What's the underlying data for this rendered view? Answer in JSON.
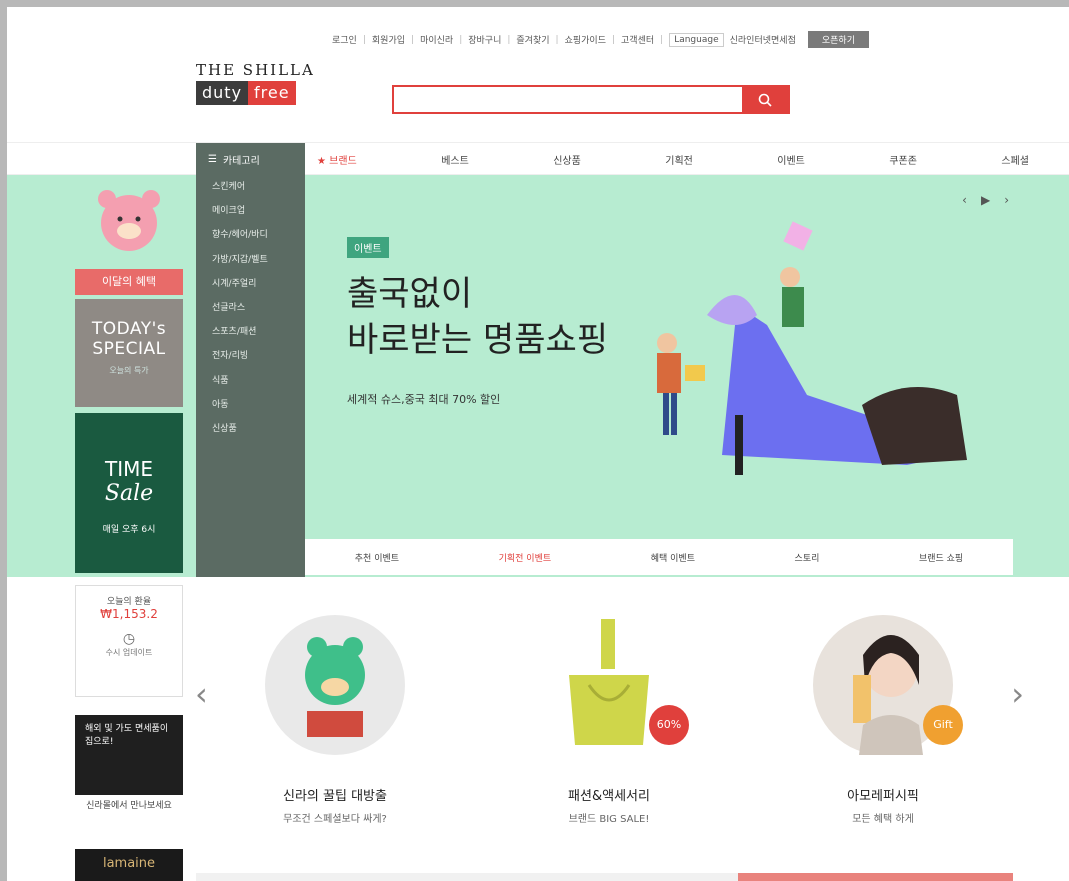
{
  "utility": {
    "links": [
      "로그인",
      "회원가입",
      "마이신라",
      "장바구니",
      "즐겨찾기",
      "쇼핑가이드",
      "고객센터"
    ],
    "language": "Language",
    "store": "신라인터넷면세점",
    "cta": "오픈하기"
  },
  "logo": {
    "line1": "THE SHILLA",
    "word_a": "duty",
    "word_b": "free"
  },
  "search": {
    "placeholder": ""
  },
  "gnb": {
    "all_label": "카테고리",
    "items": [
      "브랜드",
      "베스트",
      "신상품",
      "기획전",
      "이벤트",
      "쿠폰존",
      "스페셜"
    ],
    "hot_label": "브랜드"
  },
  "categories": [
    "스킨케어",
    "메이크업",
    "향수/헤어/바디",
    "가방/지갑/벨트",
    "시계/주얼리",
    "선글라스",
    "스포츠/패션",
    "전자/리빙",
    "식품",
    "아동",
    "신상품"
  ],
  "hero": {
    "tag": "이벤트",
    "title_line1": "출국없이",
    "title_line2": "바로받는 명품쇼핑",
    "subtitle": "세계적 슈스,중국 최대 70% 할인",
    "tabs": [
      "추천 이벤트",
      "기획전 이벤트",
      "혜택 이벤트",
      "스토리",
      "브랜드 쇼핑"
    ],
    "active_tab": 1
  },
  "side": {
    "bear_label": "이달의 혜택",
    "today_line1": "TODAY's",
    "today_line2": "SPECIAL",
    "today_small": "오늘의 특가",
    "time_w1": "TIME",
    "time_w2": "Sale",
    "time_w3": "매일 오후 6시",
    "rate_title": "오늘의 환율",
    "rate_value": "₩1,153.2",
    "rate_icon": "clock-icon",
    "rate_caption": "수시 업데이트",
    "event_text": "해외 및 가도 면세품이 집으로!",
    "event_label": "신라몰에서 만나보세요",
    "lamaine": "lamaine"
  },
  "promo": [
    {
      "title": "신라의 꿀팁 대방출",
      "desc": "무조건 스페셜보다 싸게?",
      "badge": ""
    },
    {
      "title": "패션&액세서리",
      "desc": "브랜드 BIG SALE!",
      "badge": "60%"
    },
    {
      "title": "아모레퍼시픽",
      "desc": "모든 혜택 하게",
      "badge": "Gift"
    }
  ],
  "colors": {
    "accent": "#e0403c",
    "mint": "#b7ecd1",
    "menu": "#5b6b63"
  }
}
